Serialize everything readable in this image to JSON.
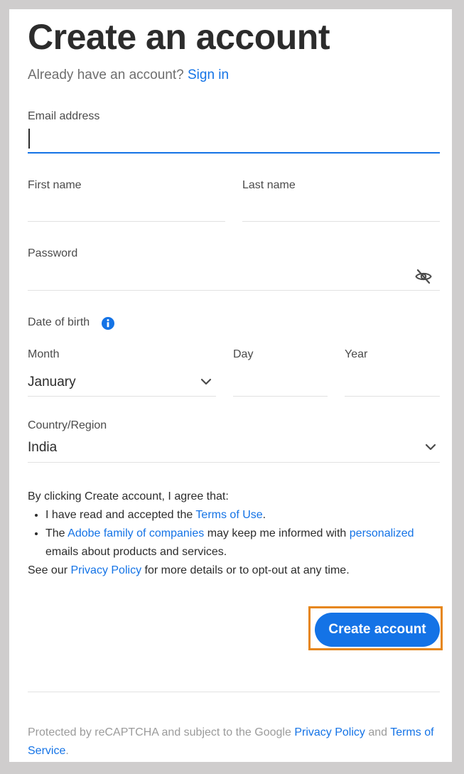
{
  "header": {
    "title": "Create an account",
    "signin_prompt": "Already have an account?",
    "signin_link": "Sign in"
  },
  "form": {
    "email": {
      "label": "Email address",
      "value": ""
    },
    "first_name": {
      "label": "First name",
      "value": ""
    },
    "last_name": {
      "label": "Last name",
      "value": ""
    },
    "password": {
      "label": "Password",
      "value": "",
      "toggle_icon": "eye-slash-icon"
    },
    "dob": {
      "label": "Date of birth",
      "info_icon": "info-icon",
      "month": {
        "label": "Month",
        "value": "January"
      },
      "day": {
        "label": "Day",
        "value": ""
      },
      "year": {
        "label": "Year",
        "value": ""
      }
    },
    "country": {
      "label": "Country/Region",
      "value": "India"
    }
  },
  "terms": {
    "intro": "By clicking Create account, I agree that:",
    "bullet1_pre": "I have read and accepted the ",
    "bullet1_link": "Terms of Use",
    "bullet1_post": ".",
    "bullet2_pre": "The ",
    "bullet2_link1": "Adobe family of companies",
    "bullet2_mid": " may keep me informed with ",
    "bullet2_link2": "personalized",
    "bullet2_post": " emails about products and services.",
    "outro_pre": "See our ",
    "outro_link": "Privacy Policy",
    "outro_post": " for more details or to opt-out at any time."
  },
  "actions": {
    "create_label": "Create account"
  },
  "footer": {
    "pre": "Protected by reCAPTCHA and subject to the Google ",
    "privacy_link": "Privacy Policy",
    "mid": " and ",
    "terms_link": "Terms of Service",
    "post": "."
  },
  "colors": {
    "accent": "#1473e6",
    "highlight": "#e68619",
    "background": "#cfcdcd"
  }
}
